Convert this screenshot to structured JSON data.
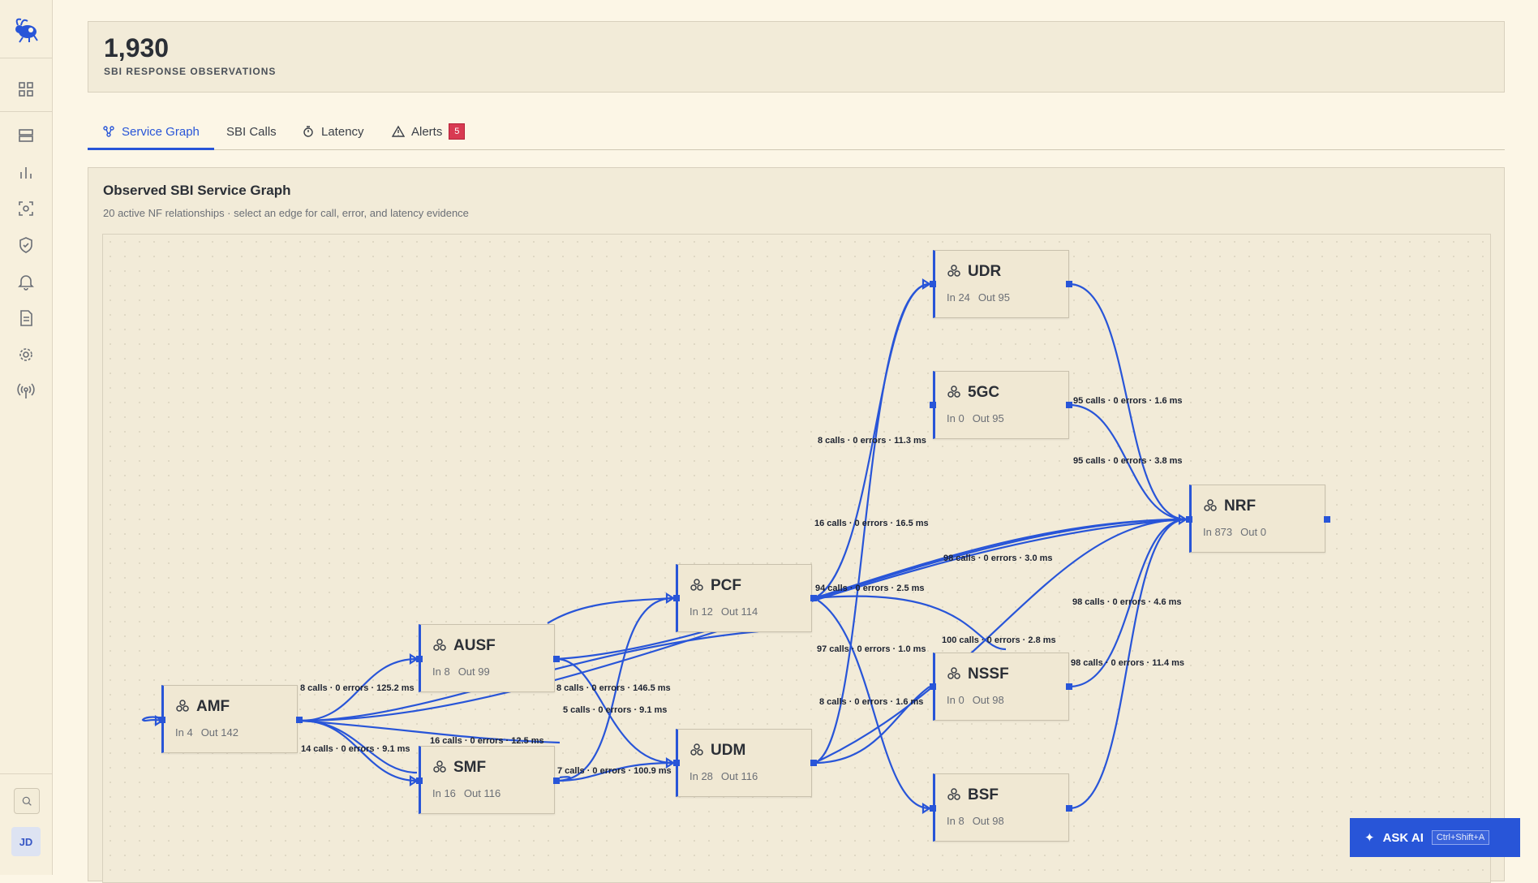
{
  "stat": {
    "value": "1,930",
    "label": "SBI RESPONSE OBSERVATIONS"
  },
  "tabs": [
    {
      "label": "Service Graph",
      "icon": "graph-icon",
      "active": true
    },
    {
      "label": "SBI Calls",
      "icon": "",
      "active": false
    },
    {
      "label": "Latency",
      "icon": "timer-icon",
      "active": false
    },
    {
      "label": "Alerts",
      "icon": "alert-triangle-icon",
      "badge": "5",
      "active": false
    }
  ],
  "panel": {
    "title": "Observed SBI Service Graph",
    "subtitle": "20 active NF relationships · select an edge for call, error, and latency evidence"
  },
  "nodes": {
    "udr": {
      "name": "UDR",
      "in": "In 24",
      "out": "Out 95"
    },
    "5gc": {
      "name": "5GC",
      "in": "In 0",
      "out": "Out 95"
    },
    "nrf": {
      "name": "NRF",
      "in": "In 873",
      "out": "Out 0"
    },
    "pcf": {
      "name": "PCF",
      "in": "In 12",
      "out": "Out 114"
    },
    "ausf": {
      "name": "AUSF",
      "in": "In 8",
      "out": "Out 99"
    },
    "amf": {
      "name": "AMF",
      "in": "In 4",
      "out": "Out 142"
    },
    "smf": {
      "name": "SMF",
      "in": "In 16",
      "out": "Out 116"
    },
    "udm": {
      "name": "UDM",
      "in": "In 28",
      "out": "Out 116"
    },
    "nssf": {
      "name": "NSSF",
      "in": "In 0",
      "out": "Out 98"
    },
    "bsf": {
      "name": "BSF",
      "in": "In 8",
      "out": "Out 98"
    }
  },
  "edge_labels": [
    "95 calls · 0 errors · 1.6 ms",
    "8 calls · 0 errors · 11.3 ms",
    "95 calls · 0 errors · 3.8 ms",
    "16 calls · 0 errors · 16.5 ms",
    "98 calls · 0 errors · 3.0 ms",
    "94 calls · 0 errors · 2.5 ms",
    "98 calls · 0 errors · 4.6 ms",
    "100 calls · 0 errors · 2.8 ms",
    "97 calls · 0 errors · 1.0 ms",
    "98 calls · 0 errors · 11.4 ms",
    "8 calls · 0 errors · 125.2 ms",
    "8 calls · 0 errors · 146.5 ms",
    "5 calls · 0 errors · 9.1 ms",
    "8 calls · 0 errors · 1.6 ms",
    "16 calls · 0 errors · 12.5 ms",
    "14 calls · 0 errors · 9.1 ms",
    "7 calls · 0 errors · 100.9 ms"
  ],
  "ask_ai": {
    "label": "ASK AI",
    "shortcut": "Ctrl+Shift+A"
  },
  "user": {
    "initials": "JD"
  },
  "colors": {
    "accent": "#2855d8",
    "background": "#fcf6e6",
    "badge": "#d83a52"
  }
}
